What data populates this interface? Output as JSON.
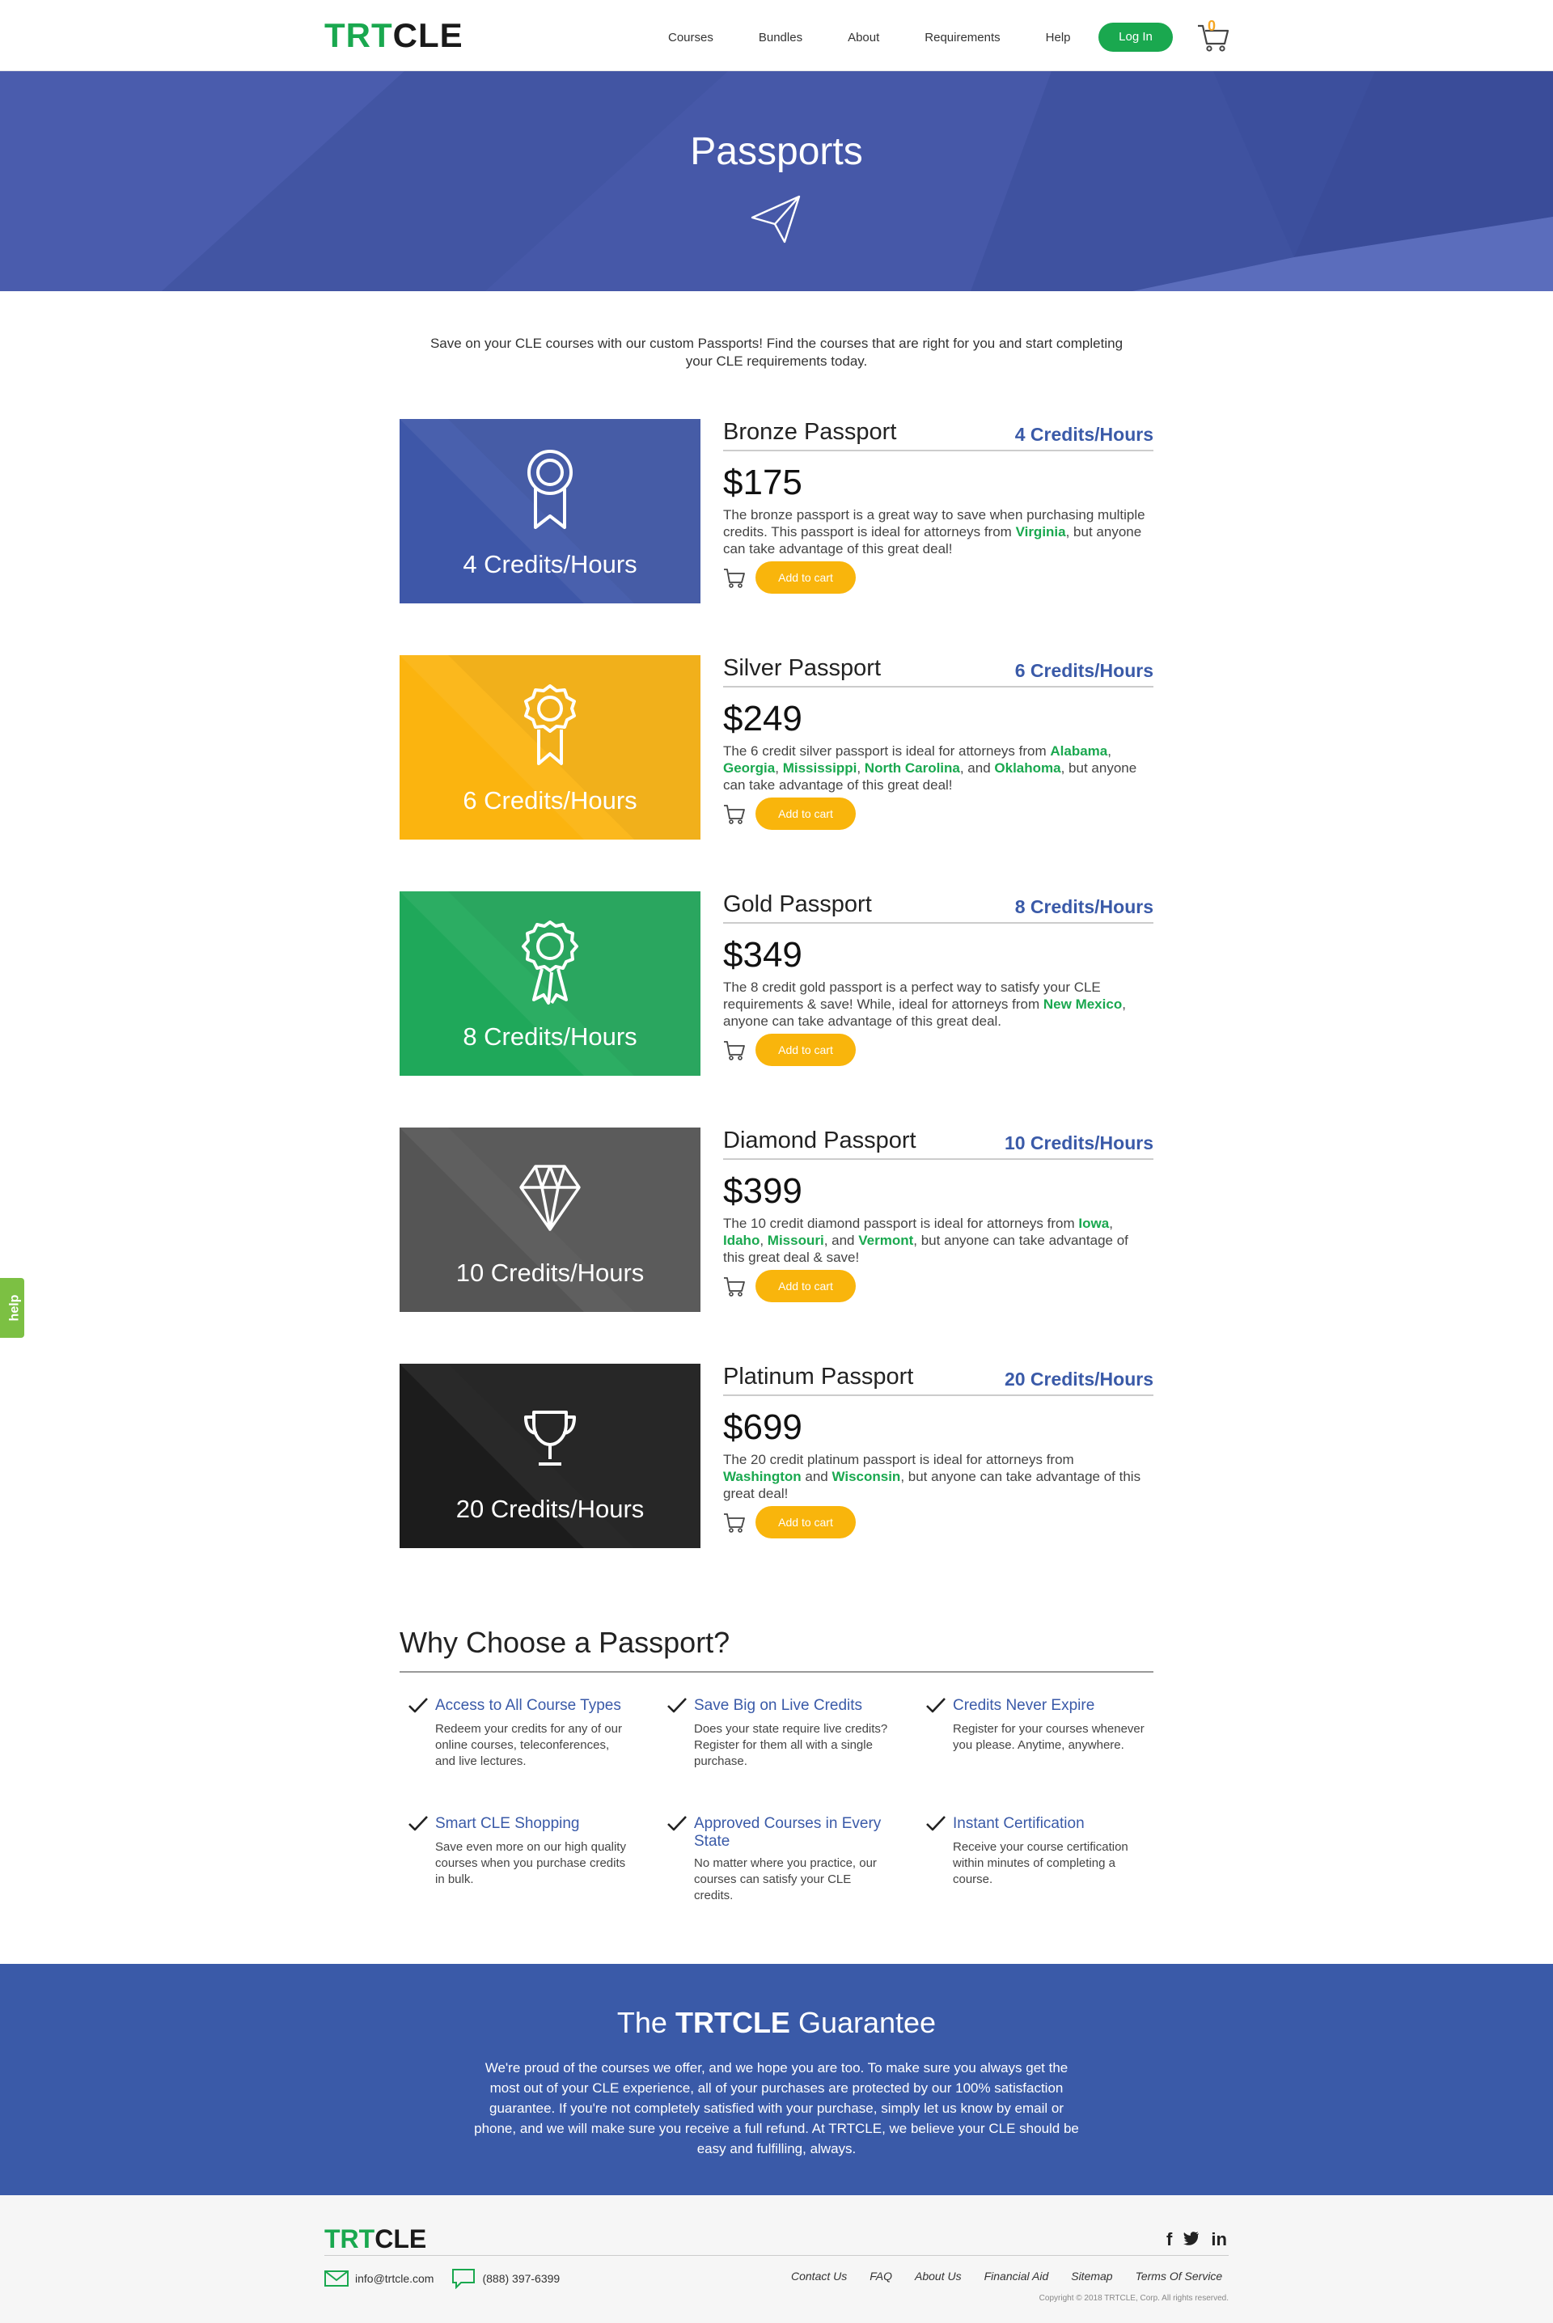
{
  "header": {
    "logo_green": "TRT",
    "logo_dark": "CLE",
    "nav": [
      "Courses",
      "Bundles",
      "About",
      "Requirements",
      "Help"
    ],
    "login_label": "Log In",
    "cart_count": "0"
  },
  "hero": {
    "title": "Passports",
    "icon": "paper-plane-icon"
  },
  "intro": "Save on your CLE courses with our custom Passports! Find the courses that are right for you and start completing your CLE requirements today.",
  "passports": [
    {
      "name": "Bronze Passport",
      "credits": "4 Credits/Hours",
      "price": "$175",
      "color": "#3e57a8",
      "icon": "ribbon-award-icon",
      "desc_parts": [
        {
          "t": "The bronze passport is a great way to save when purchasing multiple credits. This passport is ideal for attorneys from ",
          "h": false
        },
        {
          "t": "Virginia",
          "h": true
        },
        {
          "t": ", but anyone can take advantage of this great deal!",
          "h": false
        }
      ],
      "cta": "Add to cart"
    },
    {
      "name": "Silver Passport",
      "credits": "6 Credits/Hours",
      "price": "$249",
      "color": "#fbb40f",
      "icon": "rosette-award-icon",
      "desc_parts": [
        {
          "t": "The 6 credit silver passport is ideal for attorneys from ",
          "h": false
        },
        {
          "t": "Alabama",
          "h": true
        },
        {
          "t": ", ",
          "h": false
        },
        {
          "t": "Georgia",
          "h": true
        },
        {
          "t": ", ",
          "h": false
        },
        {
          "t": "Mississippi",
          "h": true
        },
        {
          "t": ", ",
          "h": false
        },
        {
          "t": "North Carolina",
          "h": true
        },
        {
          "t": ", and ",
          "h": false
        },
        {
          "t": "Oklahoma",
          "h": true
        },
        {
          "t": ", but anyone can take advantage of this great deal!",
          "h": false
        }
      ],
      "cta": "Add to cart"
    },
    {
      "name": "Gold Passport",
      "credits": "8 Credits/Hours",
      "price": "$349",
      "color": "#1fa85a",
      "icon": "medal-award-icon",
      "desc_parts": [
        {
          "t": "The 8 credit gold passport is a perfect way to satisfy your CLE requirements & save! While, ideal for attorneys from ",
          "h": false
        },
        {
          "t": "New Mexico",
          "h": true
        },
        {
          "t": ", anyone can take advantage of this great deal.",
          "h": false
        }
      ],
      "cta": "Add to cart"
    },
    {
      "name": "Diamond Passport",
      "credits": "10 Credits/Hours",
      "price": "$399",
      "color": "#555555",
      "icon": "diamond-icon",
      "desc_parts": [
        {
          "t": "The 10 credit diamond passport is ideal for attorneys from ",
          "h": false
        },
        {
          "t": "Iowa",
          "h": true
        },
        {
          "t": ", ",
          "h": false
        },
        {
          "t": "Idaho",
          "h": true
        },
        {
          "t": ", ",
          "h": false
        },
        {
          "t": "Missouri",
          "h": true
        },
        {
          "t": ", and ",
          "h": false
        },
        {
          "t": "Vermont",
          "h": true
        },
        {
          "t": ", but anyone can take advantage of this great deal & save!",
          "h": false
        }
      ],
      "cta": "Add to cart"
    },
    {
      "name": "Platinum Passport",
      "credits": "20 Credits/Hours",
      "price": "$699",
      "color": "#1c1c1c",
      "icon": "trophy-icon",
      "desc_parts": [
        {
          "t": "The 20 credit platinum passport is ideal for attorneys from ",
          "h": false
        },
        {
          "t": "Washington",
          "h": true
        },
        {
          "t": " and ",
          "h": false
        },
        {
          "t": "Wisconsin",
          "h": true
        },
        {
          "t": ", but anyone can take advantage of this great deal!",
          "h": false
        }
      ],
      "cta": "Add to cart"
    }
  ],
  "why": {
    "title": "Why Choose a Passport?",
    "features": [
      {
        "title": "Access to All Course Types",
        "desc": "Redeem your credits for any of our online courses, teleconferences, and live lectures."
      },
      {
        "title": "Save Big on Live Credits",
        "desc": "Does your state require live credits? Register for them all with a single purchase."
      },
      {
        "title": "Credits Never Expire",
        "desc": "Register for your courses whenever you please. Anytime, anywhere."
      },
      {
        "title": "Smart CLE Shopping",
        "desc": "Save even more on our high quality courses when you purchase credits in bulk."
      },
      {
        "title": "Approved Courses in Every State",
        "desc": "No matter where you practice, our courses can satisfy your CLE credits."
      },
      {
        "title": "Instant Certification",
        "desc": "Receive your course certification within minutes of completing a course."
      }
    ]
  },
  "guarantee": {
    "title_pre": "The ",
    "title_brand": "TRTCLE",
    "title_post": " Guarantee",
    "text": "We're proud of the courses we offer, and we hope you are too. To make sure you always get the most out of your CLE experience, all of your purchases are protected by our 100% satisfaction guarantee. If you're not completely satisfied with your purchase, simply let us know by email or phone, and we will make sure you receive a full refund. At TRTCLE, we believe your CLE should be easy and fulfilling, always."
  },
  "footer": {
    "logo_green": "TRT",
    "logo_dark": "CLE",
    "social": [
      "f",
      "t",
      "in"
    ],
    "email": "info@trtcle.com",
    "phone": "(888) 397-6399",
    "links": [
      "Contact Us",
      "FAQ",
      "About Us",
      "Financial Aid",
      "Sitemap",
      "Terms Of Service"
    ],
    "copyright": "Copyright © 2018 TRTCLE, Corp. All rights reserved."
  },
  "help_tab": "help"
}
